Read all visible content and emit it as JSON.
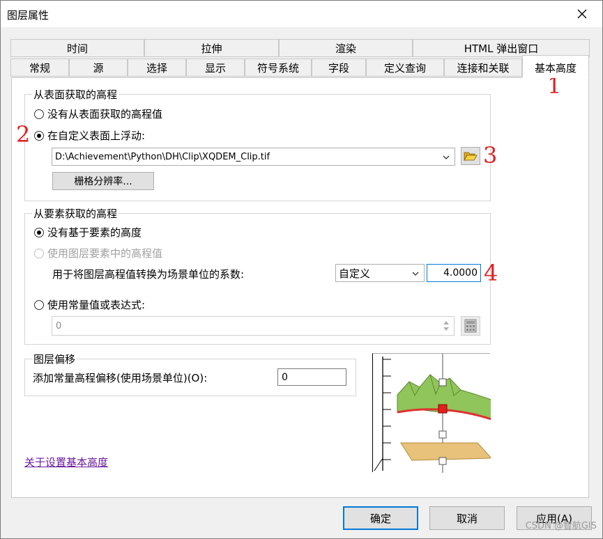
{
  "window": {
    "title": "图层属性"
  },
  "tabs_top": [
    "时间",
    "拉伸",
    "渲染",
    "HTML 弹出窗口"
  ],
  "tabs_bottom": [
    "常规",
    "源",
    "选择",
    "显示",
    "符号系统",
    "字段",
    "定义查询",
    "连接和关联",
    "基本高度"
  ],
  "active_tab": "基本高度",
  "surface_group": {
    "legend": "从表面获取的高程",
    "option_none": "没有从表面获取的高程值",
    "option_float": "在自定义表面上浮动:",
    "surface_path": "D:\\Achievement\\Python\\DH\\Clip\\XQDEM_Clip.tif",
    "raster_res_button": "栅格分辨率..."
  },
  "feature_group": {
    "legend": "从要素获取的高程",
    "option_none": "没有基于要素的高度",
    "option_layer": "使用图层要素中的高程值",
    "factor_label": "用于将图层高程值转换为场景单位的系数:",
    "factor_unit": "自定义",
    "factor_value": "4.0000",
    "option_expression": "使用常量值或表达式:",
    "expression_value": "0"
  },
  "offset_group": {
    "legend": "图层偏移",
    "offset_label": "添加常量高程偏移(使用场景单位)(O):",
    "offset_value": "0"
  },
  "help_link": "关于设置基本高度",
  "footer": {
    "ok": "确定",
    "cancel": "取消",
    "apply": "应用(A)"
  },
  "annotations": [
    "1",
    "2",
    "3",
    "4"
  ],
  "watermark": "CSDN @智航GIS",
  "colors": {
    "annotation": "#e02020",
    "accent": "#0078d7",
    "link": "#6a1b9a"
  }
}
